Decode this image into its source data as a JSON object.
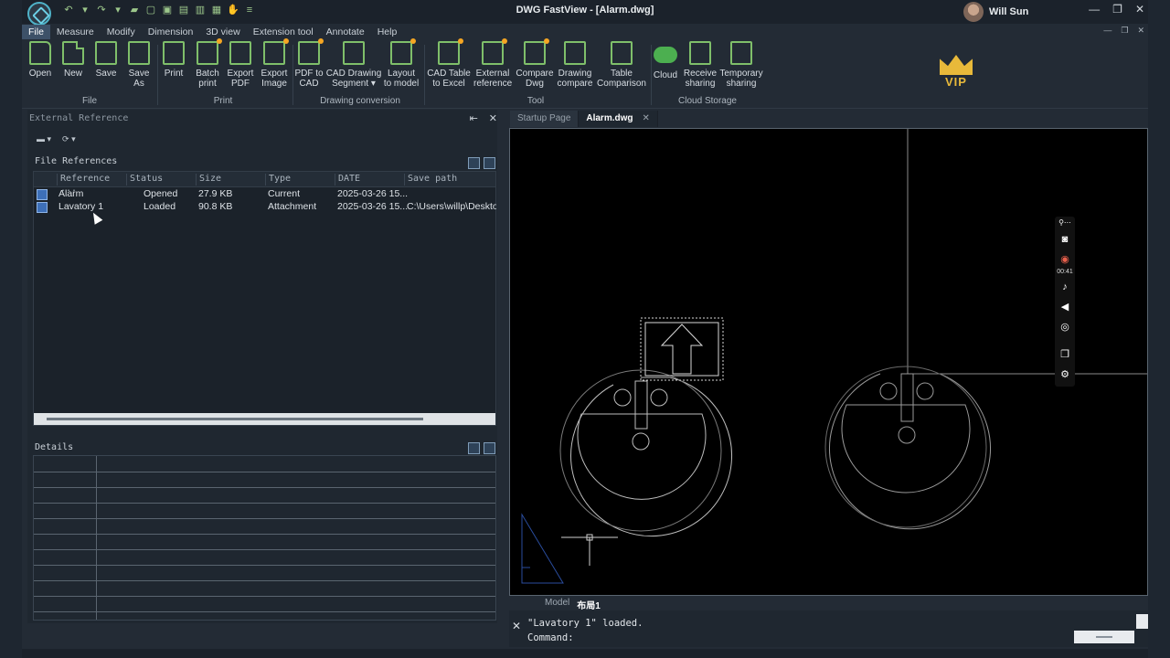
{
  "window": {
    "title": "DWG FastView - [Alarm.dwg]",
    "user_name": "Will Sun",
    "controls": [
      "—",
      "❐",
      "✕"
    ]
  },
  "menu": [
    "File",
    "Measure",
    "Modify",
    "Dimension",
    "3D view",
    "Extension tool",
    "Annotate",
    "Help"
  ],
  "ribbon": {
    "buttons": [
      "Open",
      "New",
      "Save",
      "Save\nAs",
      "Print",
      "Batch\nprint",
      "Export\nPDF",
      "Export\nImage",
      "PDF to\nCAD",
      "CAD Drawing\nSegment ▾",
      "Layout\nto model",
      "CAD Table\nto Excel",
      "External\nreference",
      "Compare\nDwg",
      "Drawing\ncompare",
      "Table\nComparison",
      "Cloud",
      "Receive\nsharing",
      "Temporary\nsharing"
    ],
    "groups": [
      "File",
      "Print",
      "Drawing conversion",
      "Tool",
      "Cloud Storage"
    ],
    "vip_label": "VIP",
    "accent_color": "#7fbf6a"
  },
  "xref_panel": {
    "title": "External Reference",
    "section_title": "File References",
    "columns": [
      "Reference ...",
      "Status",
      "Size",
      "Type",
      "DATE",
      "Save path"
    ],
    "rows": [
      [
        "Alarm",
        "Opened",
        "27.9 KB",
        "Current",
        "2025-03-26 15...",
        ""
      ],
      [
        "Lavatory 1",
        "Loaded",
        "90.8 KB",
        "Attachment",
        "2025-03-26 15...",
        "C:\\Users\\willp\\Deskto"
      ]
    ],
    "details_title": "Details"
  },
  "doc_tabs": [
    "Startup Page",
    "Alarm.dwg"
  ],
  "layout_tabs": [
    "Model",
    "布局1"
  ],
  "recorder": {
    "time": "00:41"
  },
  "command": {
    "history": "\"Lavatory 1\" loaded.",
    "prompt": "Command:"
  }
}
